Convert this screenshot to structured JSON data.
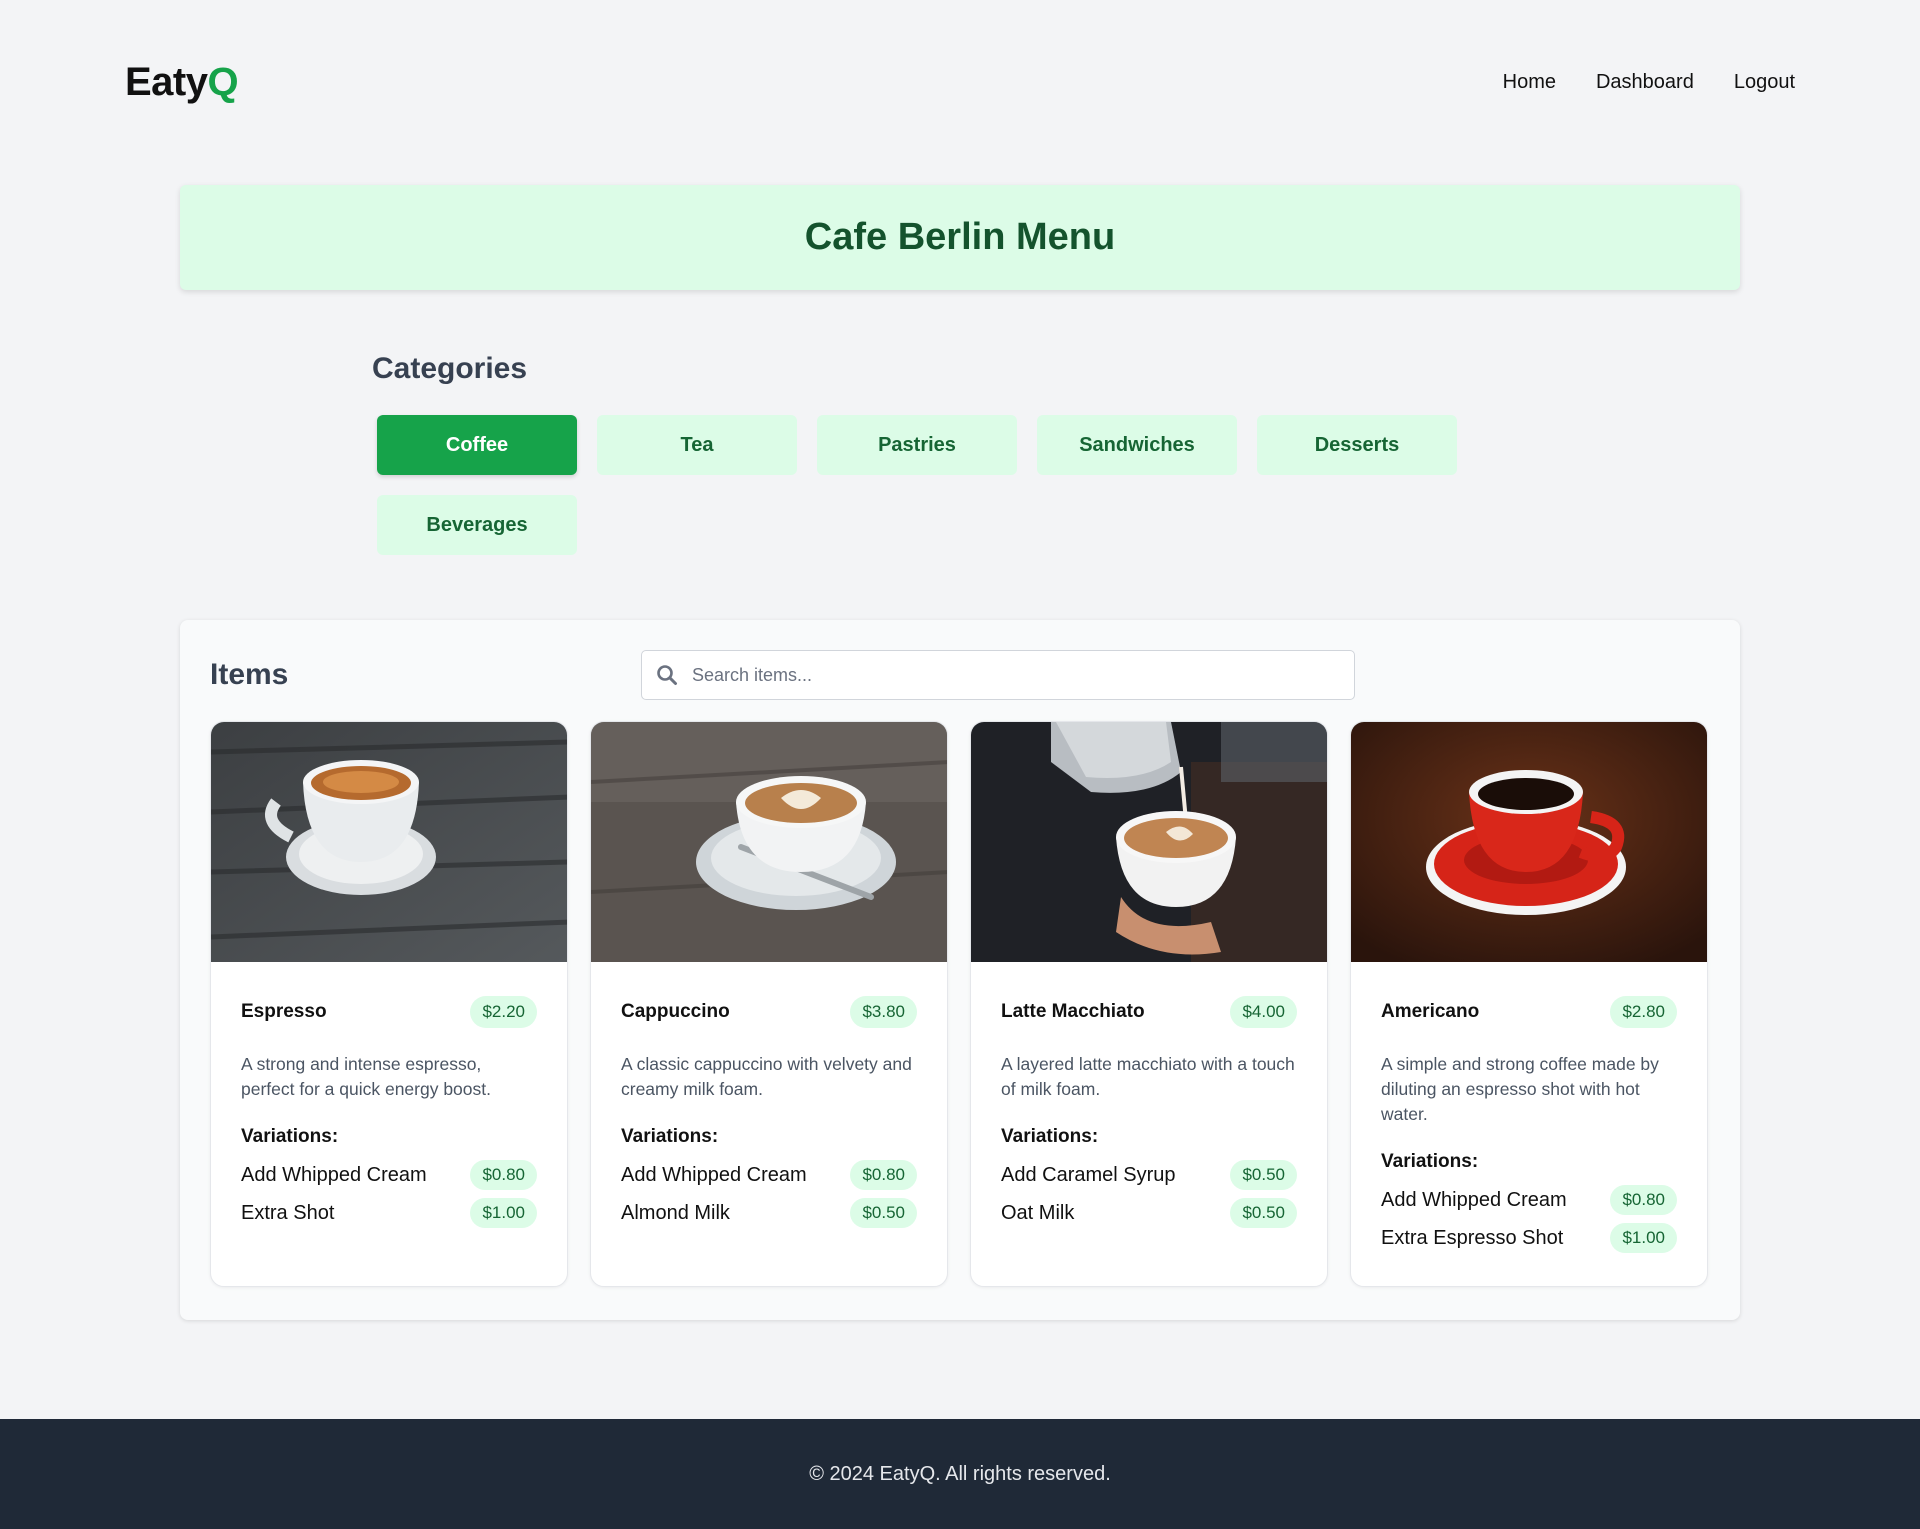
{
  "brand": {
    "name_main": "Eaty",
    "name_accent": "Q",
    "accent_color": "#16a34a"
  },
  "nav": {
    "home": "Home",
    "dashboard": "Dashboard",
    "logout": "Logout"
  },
  "banner": {
    "title": "Cafe Berlin Menu"
  },
  "categories": {
    "title": "Categories",
    "active": "Coffee",
    "items": [
      "Coffee",
      "Tea",
      "Pastries",
      "Sandwiches",
      "Desserts",
      "Beverages"
    ]
  },
  "items_section": {
    "title": "Items",
    "search_placeholder": "Search items...",
    "variations_label": "Variations:",
    "cards": [
      {
        "name": "Espresso",
        "price": "$2.20",
        "image": "espresso-cup-photo",
        "description": "A strong and intense espresso, perfect for a quick energy boost.",
        "variations": [
          {
            "name": "Add Whipped Cream",
            "price": "$0.80"
          },
          {
            "name": "Extra Shot",
            "price": "$1.00"
          }
        ]
      },
      {
        "name": "Cappuccino",
        "price": "$3.80",
        "image": "cappuccino-latte-art-photo",
        "description": "A classic cappuccino with velvety and creamy milk foam.",
        "variations": [
          {
            "name": "Add Whipped Cream",
            "price": "$0.80"
          },
          {
            "name": "Almond Milk",
            "price": "$0.50"
          }
        ]
      },
      {
        "name": "Latte Macchiato",
        "price": "$4.00",
        "image": "latte-pour-photo",
        "description": "A layered latte macchiato with a touch of milk foam.",
        "variations": [
          {
            "name": "Add Caramel Syrup",
            "price": "$0.50"
          },
          {
            "name": "Oat Milk",
            "price": "$0.50"
          }
        ]
      },
      {
        "name": "Americano",
        "price": "$2.80",
        "image": "red-cup-americano-photo",
        "description": "A simple and strong coffee made by diluting an espresso shot with hot water.",
        "variations": [
          {
            "name": "Add Whipped Cream",
            "price": "$0.80"
          },
          {
            "name": "Extra Espresso Shot",
            "price": "$1.00"
          }
        ]
      }
    ]
  },
  "footer": {
    "text": "© 2024 EatyQ. All rights reserved."
  }
}
